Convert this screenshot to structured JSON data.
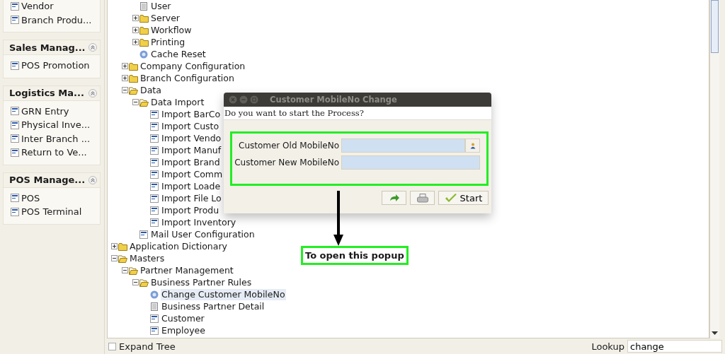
{
  "sidebar": {
    "panels": [
      {
        "items": [
          "Vendor",
          "Branch Produ..."
        ]
      },
      {
        "title": "Sales Manag...",
        "items": [
          "POS Promotion"
        ]
      },
      {
        "title": "Logistics Ma...",
        "items": [
          "GRN Entry",
          "Physical Inve...",
          "Inter Branch ...",
          "Return to Ve..."
        ]
      },
      {
        "title": "POS Manage...",
        "items": [
          "POS",
          "POS Terminal"
        ]
      }
    ]
  },
  "tree": {
    "nodes": [
      {
        "children": [
          {
            "children": [
              {
                "label": "User",
                "kind": "report",
                "selected": false
              },
              {
                "label": "Server",
                "kind": "folder",
                "expanded": false,
                "selected": false
              },
              {
                "label": "Workflow",
                "kind": "folder",
                "expanded": false,
                "selected": false
              },
              {
                "label": "Printing",
                "kind": "folder",
                "expanded": false,
                "selected": false
              },
              {
                "label": "Cache Reset",
                "kind": "process",
                "selected": false
              }
            ]
          },
          {
            "label": "Company Configuration",
            "kind": "folder",
            "expanded": false,
            "selected": false
          },
          {
            "label": "Branch Configuration",
            "kind": "folder",
            "expanded": false,
            "selected": false
          },
          {
            "label": "Data",
            "kind": "folder",
            "expanded": true,
            "selected": false,
            "children": [
              {
                "label": "Data Import",
                "kind": "folder",
                "expanded": true,
                "selected": false,
                "children": [
                  {
                    "label": "Import BarCo",
                    "kind": "window",
                    "selected": false
                  },
                  {
                    "label": "Import Custo",
                    "kind": "window",
                    "selected": false
                  },
                  {
                    "label": "Import Vendo",
                    "kind": "window",
                    "selected": false
                  },
                  {
                    "label": "Import Manuf",
                    "kind": "window",
                    "selected": false
                  },
                  {
                    "label": "Import Brand",
                    "kind": "window",
                    "selected": false
                  },
                  {
                    "label": "Import Comm",
                    "kind": "window",
                    "selected": false
                  },
                  {
                    "label": "Import Loade",
                    "kind": "window",
                    "selected": false
                  },
                  {
                    "label": "Import File Lo",
                    "kind": "window",
                    "selected": false
                  },
                  {
                    "label": "Import Produ",
                    "kind": "window",
                    "selected": false
                  },
                  {
                    "label": "Import Inventory",
                    "kind": "window",
                    "selected": false
                  }
                ]
              },
              {
                "label": "Mail User Configuration",
                "kind": "window",
                "selected": false
              }
            ]
          }
        ]
      },
      {
        "label": "Application Dictionary",
        "kind": "folder",
        "expanded": false,
        "selected": false
      },
      {
        "label": "Masters",
        "kind": "folder",
        "expanded": true,
        "selected": false,
        "children": [
          {
            "label": "Partner Management",
            "kind": "folder",
            "expanded": true,
            "selected": false,
            "children": [
              {
                "label": "Business Partner Rules",
                "kind": "folder",
                "expanded": true,
                "selected": false,
                "children": [
                  {
                    "label": "Change Customer MobileNo",
                    "kind": "process",
                    "selected": true
                  },
                  {
                    "label": "Business Partner Detail",
                    "kind": "report",
                    "selected": false
                  },
                  {
                    "label": "Customer",
                    "kind": "window",
                    "selected": false
                  },
                  {
                    "label": "Employee",
                    "kind": "window",
                    "selected": false
                  }
                ]
              }
            ]
          }
        ]
      }
    ]
  },
  "bottom_bar": {
    "expand_tree": {
      "label": "Expand Tree",
      "checked": false
    },
    "lookup": {
      "label": "Lookup",
      "value": "change"
    }
  },
  "dialog": {
    "title": "Customer MobileNo Change",
    "prompt": "Do you want to start the Process?",
    "fields": [
      {
        "label": "Customer Old MobileNo",
        "kind": "lookup"
      },
      {
        "label": "Customer New MobileNo",
        "kind": "text"
      }
    ],
    "start_button": "Start"
  },
  "annotation": {
    "text": "To open this popup"
  }
}
